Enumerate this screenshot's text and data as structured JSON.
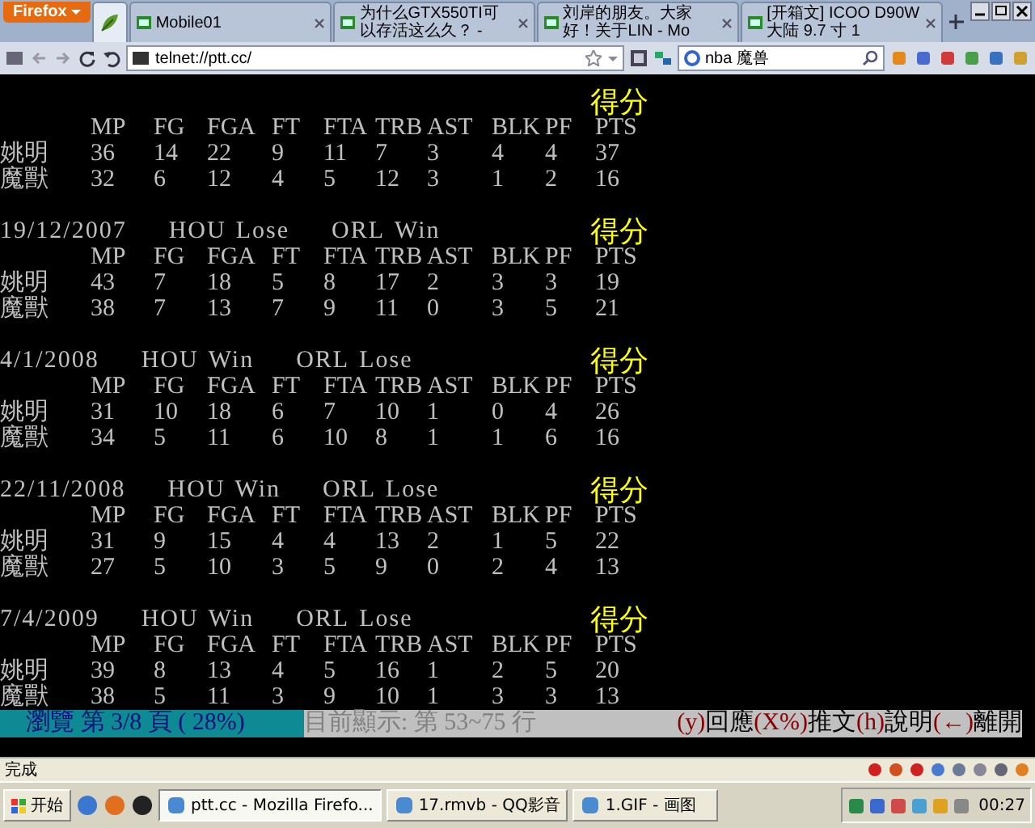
{
  "browser": {
    "menu_button": "Firefox",
    "tabs": [
      {
        "kind": "app",
        "selected": true
      },
      {
        "kind": "page",
        "label": "Mobile01",
        "selected": false
      },
      {
        "kind": "page",
        "label": "为什么GTX550TI可以存活这么久？ -",
        "selected": false
      },
      {
        "kind": "page",
        "label": "刘岸的朋友。大家好！关于LIN - Mo",
        "selected": false
      },
      {
        "kind": "page",
        "label": "[开箱文] ICOO D90W 大陆 9.7 寸 1",
        "selected": false
      }
    ],
    "address": "telnet://ptt.cc/",
    "search": "nba 魔兽"
  },
  "terminal": {
    "blocks": [
      {
        "score_label": "得分",
        "columns": [
          "MP",
          "FG",
          "FGA",
          "FT",
          "FTA",
          "TRB",
          "AST",
          "BLK",
          "PF",
          "PTS"
        ],
        "rows": [
          {
            "name": "姚明",
            "values": [
              "36",
              "14",
              "22",
              "9",
              "11",
              "7",
              "3",
              "4",
              "4",
              "37"
            ]
          },
          {
            "name": "魔獸",
            "values": [
              "32",
              "6",
              "12",
              "4",
              "5",
              "12",
              "3",
              "1",
              "2",
              "16"
            ]
          }
        ]
      },
      {
        "date": "19/12/2007",
        "teams": [
          {
            "team": "HOU",
            "result": "Lose"
          },
          {
            "team": "ORL",
            "result": "Win"
          }
        ],
        "score_label": "得分",
        "columns": [
          "MP",
          "FG",
          "FGA",
          "FT",
          "FTA",
          "TRB",
          "AST",
          "BLK",
          "PF",
          "PTS"
        ],
        "rows": [
          {
            "name": "姚明",
            "values": [
              "43",
              "7",
              "18",
              "5",
              "8",
              "17",
              "2",
              "3",
              "3",
              "19"
            ]
          },
          {
            "name": "魔獸",
            "values": [
              "38",
              "7",
              "13",
              "7",
              "9",
              "11",
              "0",
              "3",
              "5",
              "21"
            ]
          }
        ]
      },
      {
        "date": "4/1/2008",
        "teams": [
          {
            "team": "HOU",
            "result": "Win"
          },
          {
            "team": "ORL",
            "result": "Lose"
          }
        ],
        "score_label": "得分",
        "columns": [
          "MP",
          "FG",
          "FGA",
          "FT",
          "FTA",
          "TRB",
          "AST",
          "BLK",
          "PF",
          "PTS"
        ],
        "rows": [
          {
            "name": "姚明",
            "values": [
              "31",
              "10",
              "18",
              "6",
              "7",
              "10",
              "1",
              "0",
              "4",
              "26"
            ]
          },
          {
            "name": "魔獸",
            "values": [
              "34",
              "5",
              "11",
              "6",
              "10",
              "8",
              "1",
              "1",
              "6",
              "16"
            ]
          }
        ]
      },
      {
        "date": "22/11/2008",
        "teams": [
          {
            "team": "HOU",
            "result": "Win"
          },
          {
            "team": "ORL",
            "result": "Lose"
          }
        ],
        "score_label": "得分",
        "columns": [
          "MP",
          "FG",
          "FGA",
          "FT",
          "FTA",
          "TRB",
          "AST",
          "BLK",
          "PF",
          "PTS"
        ],
        "rows": [
          {
            "name": "姚明",
            "values": [
              "31",
              "9",
              "15",
              "4",
              "4",
              "13",
              "2",
              "1",
              "5",
              "22"
            ]
          },
          {
            "name": "魔獸",
            "values": [
              "27",
              "5",
              "10",
              "3",
              "5",
              "9",
              "0",
              "2",
              "4",
              "13"
            ]
          }
        ]
      },
      {
        "date": "7/4/2009",
        "teams": [
          {
            "team": "HOU",
            "result": "Win"
          },
          {
            "team": "ORL",
            "result": "Lose"
          }
        ],
        "score_label": "得分",
        "columns": [
          "MP",
          "FG",
          "FGA",
          "FT",
          "FTA",
          "TRB",
          "AST",
          "BLK",
          "PF",
          "PTS"
        ],
        "rows": [
          {
            "name": "姚明",
            "values": [
              "39",
              "8",
              "13",
              "4",
              "5",
              "16",
              "1",
              "2",
              "5",
              "20"
            ]
          },
          {
            "name": "魔獸",
            "values": [
              "38",
              "5",
              "11",
              "3",
              "9",
              "10",
              "1",
              "3",
              "3",
              "13"
            ]
          }
        ]
      }
    ],
    "status_line": {
      "page_info": "瀏覽 第 3/8 頁 ( 28%)",
      "range_info": "目前顯示: 第 53~75 行",
      "hints": [
        {
          "key": "(y)",
          "action": "回應"
        },
        {
          "key": "(X%)",
          "action": "推文"
        },
        {
          "key": "(h)",
          "action": "說明"
        },
        {
          "key": "(←)",
          "action": "離開"
        }
      ]
    }
  },
  "status_bar": "完成",
  "taskbar": {
    "start": "开始",
    "tasks": [
      {
        "label": "ptt.cc - Mozilla Firefo...",
        "selected": true
      },
      {
        "label": "17.rmvb - QQ影音",
        "selected": false
      },
      {
        "label": "1.GIF - 画图",
        "selected": false
      }
    ],
    "clock": "00:27"
  }
}
